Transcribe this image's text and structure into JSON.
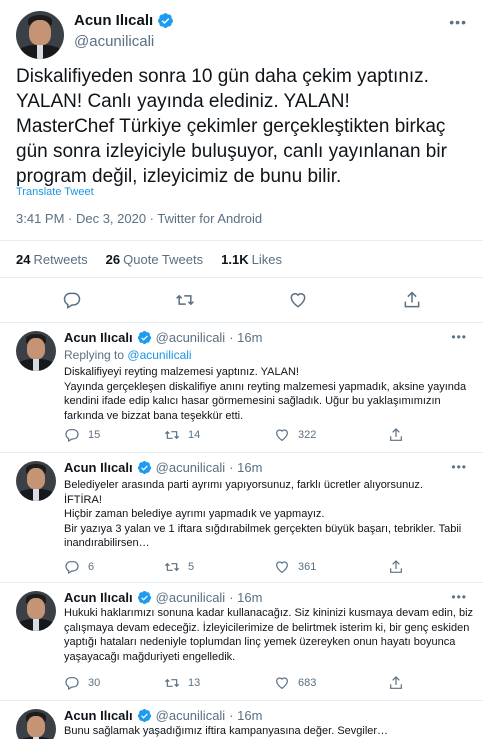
{
  "main_tweet": {
    "name": "Acun Ilıcalı",
    "handle": "@acunilicali",
    "more": "•••",
    "text": "Diskalifiyeden sonra 10 gün daha çekim yaptınız.\nYALAN! Canlı yayında elediniz. YALAN!\nMasterChef Türkiye çekimler gerçekleştikten birkaç gün sonra izleyiciyle buluşuyor, canlı yayınlanan bir program değil, izleyicimiz de bunu bilir.",
    "translate": "Translate Tweet",
    "meta": "3:41 PM · Dec 3, 2020 · Twitter for Android",
    "stats": {
      "retweets_count": "24",
      "retweets_label": "Retweets",
      "quotes_count": "26",
      "quotes_label": "Quote Tweets",
      "likes_count": "1.1K",
      "likes_label": "Likes"
    }
  },
  "replies": [
    {
      "name": "Acun Ilıcalı",
      "handle": "@acunilicali",
      "time": "· 16m",
      "more": "•••",
      "replying_prefix": "Replying to",
      "replying_to": "@acunilicali",
      "text": "Diskalifiyeyi reyting malzemesi yaptınız. YALAN!\nYayında gerçekleşen diskalifiye anını reyting malzemesi yapmadık, aksine yayında kendini ifade edip kalıcı hasar görmemesini sağladık. Uğur bu yaklaşımımızın farkında ve bizzat bana teşekkür etti.",
      "reply_count": "15",
      "retweet_count": "14",
      "like_count": "322"
    },
    {
      "name": "Acun Ilıcalı",
      "handle": "@acunilicali",
      "time": "· 16m",
      "more": "•••",
      "text": "Belediyeler arasında parti ayrımı yapıyorsunuz, farklı ücretler alıyorsunuz.\nİFTİRA!\nHiçbir zaman belediye ayrımı yapmadık ve yapmayız.\nBir yazıya 3 yalan ve 1 iftara sığdırabilmek gerçekten büyük başarı, tebrikler. Tabii inandırabilirsen…",
      "reply_count": "6",
      "retweet_count": "5",
      "like_count": "361"
    },
    {
      "name": "Acun Ilıcalı",
      "handle": "@acunilicali",
      "time": "· 16m",
      "more": "•••",
      "text": "Hukuki haklarımızı sonuna kadar kullanacağız. Siz kininizi kusmaya devam edin, biz çalışmaya devam edeceğiz. İzleyicilerimize de belirtmek isterim ki, bir genç eskiden yaptığı hataları nedeniyle toplumdan linç yemek üzereyken onun hayatı boyunca yaşayacağı mağduriyeti engelledik.",
      "reply_count": "30",
      "retweet_count": "13",
      "like_count": "683"
    },
    {
      "name": "Acun Ilıcalı",
      "handle": "@acunilicali",
      "time": "· 16m",
      "text": "Bunu sağlamak yaşadığımız iftira kampanyasına değer. Sevgiler…"
    }
  ],
  "colors": {
    "accent": "#1b95e0",
    "muted": "#5b7083",
    "border": "#e6ecf0",
    "thread": "#c4cfd6"
  }
}
